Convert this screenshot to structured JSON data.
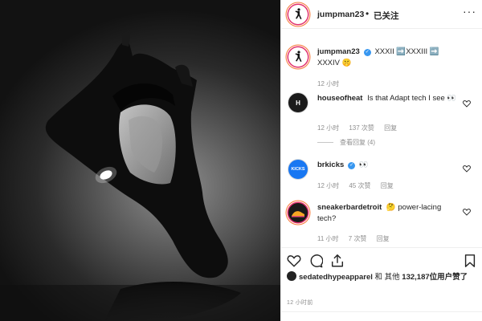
{
  "account": {
    "username": "jumpman23",
    "follow_status": "已关注",
    "separator": "•"
  },
  "caption": {
    "username": "jumpman23",
    "text": "XXXII ➡️XXXIII ➡️ XXXIV 🤫",
    "time": "12 小时"
  },
  "comments": [
    {
      "username": "houseofheat",
      "text": "Is that Adapt tech I see 👀",
      "time": "12 小时",
      "likes": "137 次赞",
      "reply_label": "回复",
      "view_replies": "查看回复 (4)"
    },
    {
      "username": "brkicks",
      "text": "👀",
      "time": "12 小时",
      "likes": "45 次赞",
      "reply_label": "回复",
      "avatar_text": "KICKS"
    },
    {
      "username": "sneakerbardetroit",
      "text": "🤔 power-lacing tech?",
      "time": "11 小时",
      "likes": "7 次赞",
      "reply_label": "回复"
    }
  ],
  "likes": {
    "user": "sedatedhypeapparel",
    "connector": "和 其他",
    "count": "132,187",
    "suffix": "位用户赞了"
  },
  "post_time": "12 小时前",
  "colors": {
    "verified": "#3897f0",
    "story_ring": "#e1306c",
    "meta_text": "#8e8e8e"
  },
  "icons": {
    "header_more": "more-horizontal-icon",
    "heart": "heart-icon",
    "comment": "comment-icon",
    "share": "share-icon",
    "save": "bookmark-icon"
  }
}
